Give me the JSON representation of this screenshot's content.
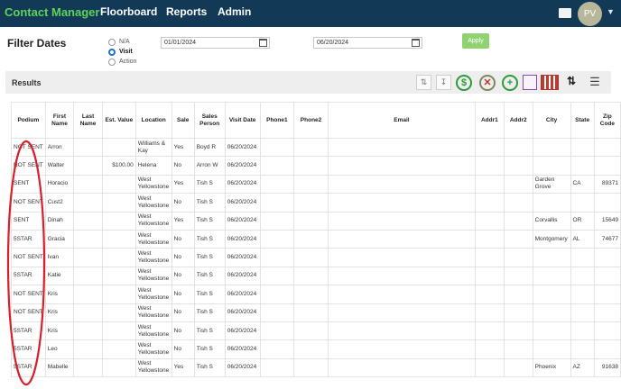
{
  "nav": {
    "brand": "Contact Manager",
    "items": [
      "Floorboard",
      "Reports",
      "Admin"
    ],
    "avatar_initials": "PV",
    "colors": {
      "bar": "#123a57",
      "brand": "#5fd35a"
    }
  },
  "filter": {
    "title": "Filter Dates",
    "options": [
      {
        "label": "N/A",
        "selected": false
      },
      {
        "label": "Visit",
        "selected": true
      },
      {
        "label": "Action",
        "selected": false
      }
    ],
    "start_date": "01/01/2024",
    "end_date": "06/20/2024",
    "apply_label": "Apply"
  },
  "results": {
    "title": "Results",
    "toolbar_icons": [
      "refresh-icon",
      "download-icon",
      "dollar-icon",
      "no-dollar-icon",
      "add-icon",
      "notes-icon",
      "calendar-grid-icon",
      "sort-icon",
      "menu-icon"
    ],
    "columns": [
      "Podium",
      "First Name",
      "Last Name",
      "Est. Value",
      "Location",
      "Sale",
      "Sales Person",
      "Visit Date",
      "Phone1",
      "Phone2",
      "Email",
      "Addr1",
      "Addr2",
      "City",
      "State",
      "Zip Code"
    ],
    "rows": [
      [
        "NOT SENT",
        "Arron",
        "",
        "",
        "Williams & Kay",
        "Yes",
        "Boyd R",
        "06/20/2024",
        "",
        "",
        "",
        "",
        "",
        "",
        "",
        ""
      ],
      [
        "NOT SENT",
        "Walter",
        "",
        "$100.00",
        "Helena",
        "No",
        "Arron W",
        "06/20/2024",
        "",
        "",
        "",
        "",
        "",
        "",
        "",
        ""
      ],
      [
        "SENT",
        "Horacio",
        "",
        "",
        "West Yellowstone",
        "Yes",
        "Tish S",
        "06/20/2024",
        "",
        "",
        "",
        "",
        "",
        "Garden Grove",
        "CA",
        "89371"
      ],
      [
        "NOT SENT",
        "Cust2",
        "",
        "",
        "West Yellowstone",
        "No",
        "Tish S",
        "06/20/2024",
        "",
        "",
        "",
        "",
        "",
        "",
        "",
        ""
      ],
      [
        "SENT",
        "Dinah",
        "",
        "",
        "West Yellowstone",
        "Yes",
        "Tish S",
        "06/20/2024",
        "",
        "",
        "",
        "",
        "",
        "Corvallis",
        "OR",
        "15649"
      ],
      [
        "5STAR",
        "Gracia",
        "",
        "",
        "West Yellowstone",
        "No",
        "Tish S",
        "06/20/2024",
        "",
        "",
        "",
        "",
        "",
        "Montgomery",
        "AL",
        "74677"
      ],
      [
        "NOT SENT",
        "Ivan",
        "",
        "",
        "West Yellowstone",
        "No",
        "Tish S",
        "06/20/2024",
        "",
        "",
        "",
        "",
        "",
        "",
        "",
        ""
      ],
      [
        "5STAR",
        "Katie",
        "",
        "",
        "West Yellowstone",
        "No",
        "Tish S",
        "06/20/2024",
        "",
        "",
        "",
        "",
        "",
        "",
        "",
        ""
      ],
      [
        "NOT SENT",
        "Kris",
        "",
        "",
        "West Yellowstone",
        "No",
        "Tish S",
        "06/20/2024",
        "",
        "",
        "",
        "",
        "",
        "",
        "",
        ""
      ],
      [
        "NOT SENT",
        "Kris",
        "",
        "",
        "West Yellowstone",
        "No",
        "Tish S",
        "06/20/2024",
        "",
        "",
        "",
        "",
        "",
        "",
        "",
        ""
      ],
      [
        "5STAR",
        "Kris",
        "",
        "",
        "West Yellowstone",
        "No",
        "Tish S",
        "06/20/2024",
        "",
        "",
        "",
        "",
        "",
        "",
        "",
        ""
      ],
      [
        "5STAR",
        "Leo",
        "",
        "",
        "West Yellowstone",
        "No",
        "Tish S",
        "06/20/2024",
        "",
        "",
        "",
        "",
        "",
        "",
        "",
        ""
      ],
      [
        "5STAR",
        "Mabelle",
        "",
        "",
        "West Yellowstone",
        "Yes",
        "Tish S",
        "06/20/2024",
        "",
        "",
        "",
        "",
        "",
        "Phoenix",
        "AZ",
        "91638"
      ]
    ]
  }
}
